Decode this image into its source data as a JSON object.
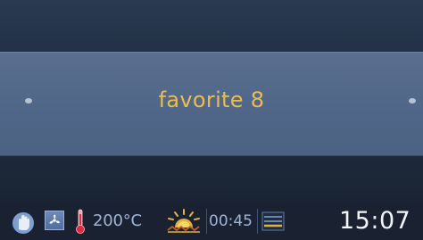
{
  "display": {
    "program_name": "favorite 8"
  },
  "status_bar": {
    "temperature": "200°C",
    "cook_time": "00:45",
    "clock": "15:07",
    "icons": [
      "hand-icon",
      "fan-icon",
      "thermometer-icon",
      "heating-element-icon",
      "rack-level-icon"
    ]
  },
  "colors": {
    "title_text": "#efbd45",
    "band": "#52688a",
    "status_text": "#9fb4d6",
    "clock_text": "#f2f4f8"
  }
}
